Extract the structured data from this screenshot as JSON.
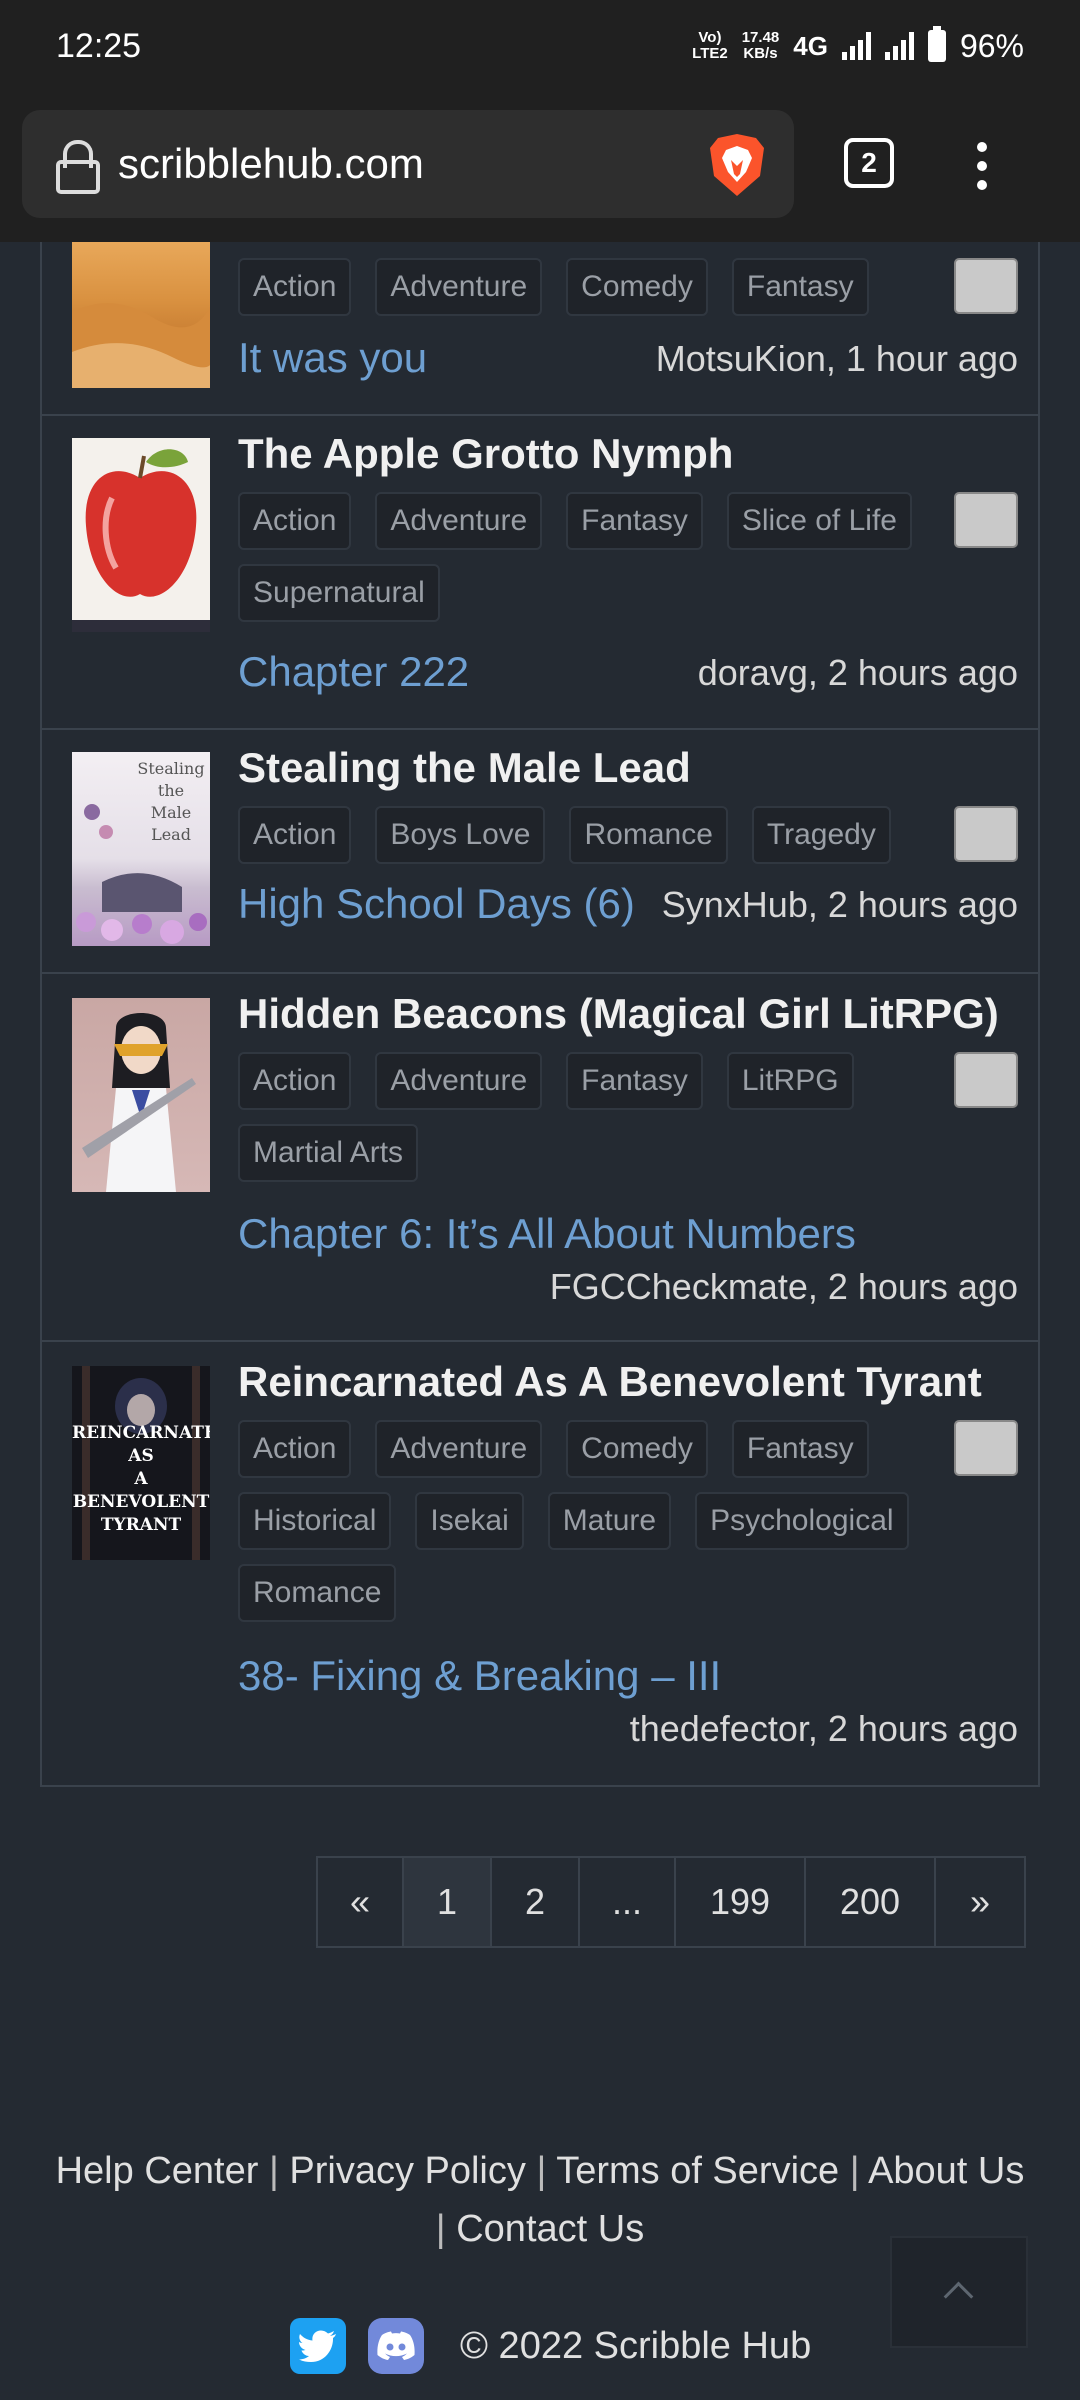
{
  "status_bar": {
    "time": "12:25",
    "volte": "Vo)\nLTE2",
    "speed": "17.48\nKB/s",
    "network": "4G",
    "battery": "96%"
  },
  "browser": {
    "url": "scribblehub.com",
    "tab_count": "2"
  },
  "series": [
    {
      "title": "",
      "tags": [
        "Action",
        "Adventure",
        "Comedy",
        "Fantasy"
      ],
      "chapter": "It was you",
      "author_time": "MotsuKion, 1 hour ago"
    },
    {
      "title": "The Apple Grotto Nymph",
      "tags": [
        "Action",
        "Adventure",
        "Fantasy",
        "Slice of Life",
        "Supernatural"
      ],
      "chapter": "Chapter 222",
      "author_time": "doravg, 2 hours ago"
    },
    {
      "title": "Stealing the Male Lead",
      "tags": [
        "Action",
        "Boys Love",
        "Romance",
        "Tragedy"
      ],
      "chapter": "High School Days (6)",
      "author_time": "SynxHub, 2 hours ago",
      "cover_text": "Stealing\nthe\nMale\nLead"
    },
    {
      "title": "Hidden Beacons (Magical Girl LitRPG)",
      "tags": [
        "Action",
        "Adventure",
        "Fantasy",
        "LitRPG",
        "Martial Arts"
      ],
      "chapter": "Chapter 6: It’s All About Numbers",
      "author_time": "FGCCheckmate, 2 hours ago"
    },
    {
      "title": "Reincarnated As A Benevolent Tyrant",
      "tags": [
        "Action",
        "Adventure",
        "Comedy",
        "Fantasy",
        "Historical",
        "Isekai",
        "Mature",
        "Psychological",
        "Romance"
      ],
      "chapter": "38- Fixing & Breaking – III",
      "author_time": "thedefector, 2 hours ago",
      "cover_text": "REINCARNATED\nAS\nA\nBENEVOLENT\nTYRANT"
    }
  ],
  "pagination": {
    "prev": "«",
    "pages": [
      "1",
      "2",
      "...",
      "199",
      "200"
    ],
    "next": "»",
    "current": "1"
  },
  "footer": {
    "links": [
      "Help Center",
      "Privacy Policy",
      "Terms of Service",
      "About Us",
      "Contact Us"
    ],
    "separator": "|",
    "copyright": "© 2022 Scribble Hub"
  },
  "colors": {
    "background": "#242a32",
    "link": "#6e9fd1",
    "tag_bg": "#1f2329",
    "twitter": "#1da1f2",
    "discord": "#7289da"
  }
}
